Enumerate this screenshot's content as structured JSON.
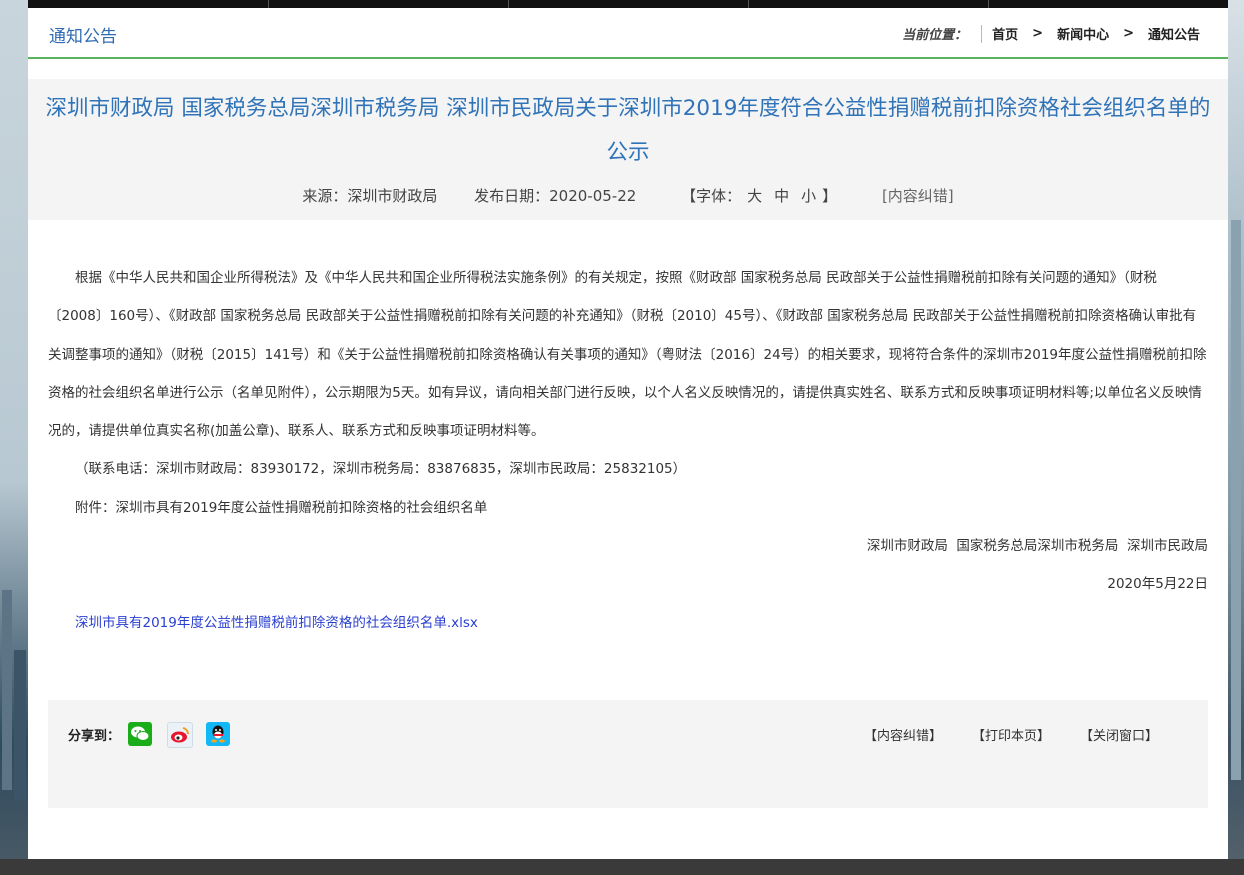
{
  "header": {
    "section_title": "通知公告",
    "location_label": "当前位置：",
    "breadcrumbs": [
      "首页",
      "新闻中心",
      "通知公告"
    ],
    "separator": ">"
  },
  "article": {
    "title": "深圳市财政局 国家税务总局深圳市税务局 深圳市民政局关于深圳市2019年度符合公益性捐赠税前扣除资格社会组织名单的公示",
    "source": "来源：深圳市财政局",
    "date": "发布日期：2020-05-22",
    "font_label_open": "【字体：",
    "font_sizes": [
      "大",
      "中",
      "小"
    ],
    "font_label_close": "】",
    "error_link": "[内容纠错]",
    "paragraph_1": "根据《中华人民共和国企业所得税法》及《中华人民共和国企业所得税法实施条例》的有关规定，按照《财政部 国家税务总局 民政部关于公益性捐赠税前扣除有关问题的通知》（财税〔2008〕160号）、《财政部 国家税务总局 民政部关于公益性捐赠税前扣除有关问题的补充通知》（财税〔2010〕45号）、《财政部 国家税务总局 民政部关于公益性捐赠税前扣除资格确认审批有关调整事项的通知》（财税〔2015〕141号）和《关于公益性捐赠税前扣除资格确认有关事项的通知》（粤财法〔2016〕24号）的相关要求，现将符合条件的深圳市2019年度公益性捐赠税前扣除资格的社会组织名单进行公示（名单见附件），公示期限为5天。如有异议，请向相关部门进行反映，以个人名义反映情况的，请提供真实姓名、联系方式和反映事项证明材料等;以单位名义反映情况的，请提供单位真实名称(加盖公章)、联系人、联系方式和反映事项证明材料等。",
    "paragraph_2": "（联系电话：深圳市财政局：83930172，深圳市税务局：83876835，深圳市民政局：25832105）",
    "paragraph_3": "附件：深圳市具有2019年度公益性捐赠税前扣除资格的社会组织名单",
    "signature": "深圳市财政局  国家税务总局深圳市税务局  深圳市民政局",
    "sign_date": "2020年5月22日",
    "attachment_link": "深圳市具有2019年度公益性捐赠税前扣除资格的社会组织名单.xlsx"
  },
  "share": {
    "label": "分享到：",
    "icons": [
      "wechat-icon",
      "weibo-icon",
      "qq-icon"
    ],
    "colors": {
      "wechat": "#1aad19",
      "weibo": "#e6162d",
      "qq": "#12b7f5"
    }
  },
  "actions": [
    "【内容纠错】",
    "【打印本页】",
    "【关闭窗口】"
  ],
  "colors": {
    "accent": "#2f73b9",
    "divider": "#58b35c",
    "link": "#2a3fd0"
  }
}
